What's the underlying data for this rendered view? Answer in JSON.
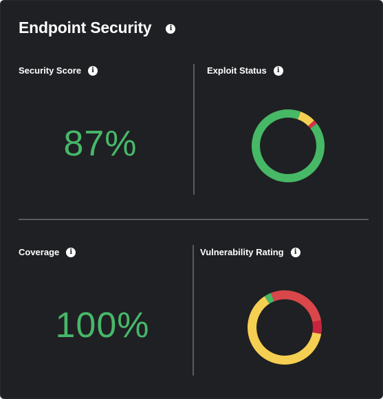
{
  "title": "Endpoint Security",
  "info_icon": "info-icon",
  "panels": {
    "security_score": {
      "label": "Security Score",
      "value": "87%"
    },
    "exploit_status": {
      "label": "Exploit Status",
      "segments": [
        {
          "name": "green",
          "fraction": 0.91,
          "color": "#46b866"
        },
        {
          "name": "yellow",
          "fraction": 0.07,
          "color": "#f5cf52"
        },
        {
          "name": "red",
          "fraction": 0.02,
          "color": "#d6304a"
        }
      ]
    },
    "coverage": {
      "label": "Coverage",
      "value": "100%"
    },
    "vulnerability_rating": {
      "label": "Vulnerability Rating",
      "segments": [
        {
          "name": "yellow",
          "fraction": 0.63,
          "color": "#f5cf52"
        },
        {
          "name": "green",
          "fraction": 0.03,
          "color": "#46b866"
        },
        {
          "name": "orange-red",
          "fraction": 0.28,
          "color": "#d9474a"
        },
        {
          "name": "crimson",
          "fraction": 0.06,
          "color": "#c8243f"
        }
      ]
    }
  },
  "colors": {
    "background": "#1f2023",
    "accent_green": "#47b86a",
    "divider": "#5a5b5e",
    "text": "#ffffff"
  }
}
